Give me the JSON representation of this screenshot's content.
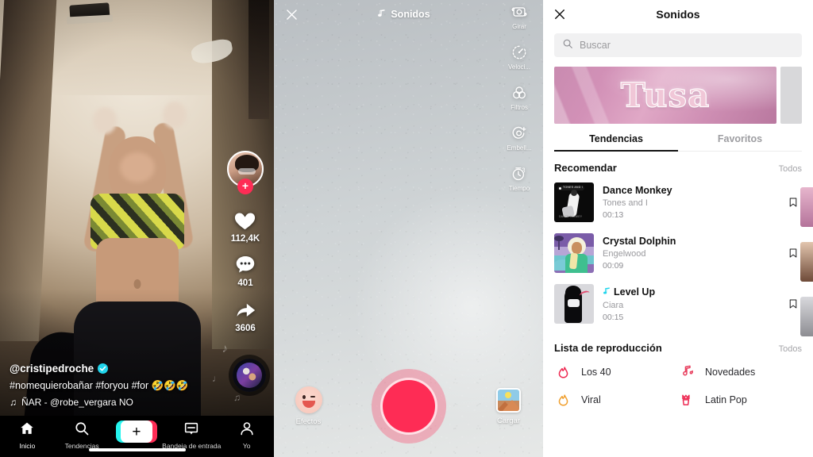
{
  "feed": {
    "author_handle": "@cristipedroche",
    "verified_icon": "verified-check-icon",
    "caption": "#nomequierobañar #foryou #for 🤣🤣🤣",
    "music_note_icon": "music-note-icon",
    "music_ticker": "ÑAR - @robe_vergara    NO",
    "actions": {
      "follow_badge": "+",
      "like_icon": "heart-icon",
      "like_count": "112,4K",
      "comment_icon": "comment-icon",
      "comment_count": "401",
      "share_icon": "share-arrow-icon",
      "share_count": "3606"
    },
    "tab_bar": [
      {
        "label": "Inicio",
        "icon": "home-icon",
        "active": true
      },
      {
        "label": "Tendencias",
        "icon": "search-icon",
        "active": false
      },
      {
        "label": "",
        "icon": "create-plus-icon",
        "active": false,
        "is_create": true
      },
      {
        "label": "Bandeja de entrada",
        "icon": "inbox-icon",
        "active": false
      },
      {
        "label": "Yo",
        "icon": "profile-icon",
        "active": false
      }
    ]
  },
  "camera": {
    "close_icon": "close-x-icon",
    "title": "Sonidos",
    "title_icon": "music-notes-icon",
    "tools": [
      {
        "label": "Girar",
        "icon": "flip-camera-icon"
      },
      {
        "label": "Veloci...",
        "icon": "speed-gauge-icon"
      },
      {
        "label": "Filtros",
        "icon": "filters-circles-icon"
      },
      {
        "label": "Embell...",
        "icon": "beautify-icon"
      },
      {
        "label": "Tiempo",
        "icon": "timer-3-icon"
      }
    ],
    "effects_label": "Efectos",
    "effects_icon": "smiley-face-icon",
    "upload_label": "Cargar",
    "upload_icon": "gallery-image-icon",
    "record_button": "record-button",
    "accent_color": "#fe2c55"
  },
  "sounds": {
    "close_icon": "close-x-icon",
    "title": "Sonidos",
    "search": {
      "icon": "search-icon",
      "placeholder": "Buscar",
      "value": ""
    },
    "banner": {
      "word": "Tusa",
      "next_card": "banner-next-peek"
    },
    "tabs": [
      {
        "label": "Tendencias",
        "active": true
      },
      {
        "label": "Favoritos",
        "active": false
      }
    ],
    "recommend": {
      "title": "Recomendar",
      "all_label": "Todos",
      "items": [
        {
          "name": "Dance Monkey",
          "artist": "Tones and I",
          "duration": "00:13",
          "bookmark_icon": "bookmark-icon",
          "badge": ""
        },
        {
          "name": " Crystal Dolphin",
          "artist": "Engelwood",
          "duration": "00:09",
          "bookmark_icon": "bookmark-icon",
          "badge": ""
        },
        {
          "name": "Level Up",
          "artist": "Ciara",
          "duration": "00:15",
          "bookmark_icon": "bookmark-icon",
          "badge": "tiktok-note-icon"
        }
      ]
    },
    "playlist": {
      "title": "Lista de reproducción",
      "all_label": "Todos",
      "items": [
        {
          "label": "Los 40",
          "icon": "flame-icon",
          "color": "#ee2b53"
        },
        {
          "label": "Novedades",
          "icon": "tiktok-note-icon",
          "color": "#e8405f"
        },
        {
          "label": "Viral",
          "icon": "flame-icon",
          "color": "#f0a030"
        },
        {
          "label": "Latin Pop",
          "icon": "crown-cup-icon",
          "color": "#ee2b53"
        }
      ]
    }
  }
}
